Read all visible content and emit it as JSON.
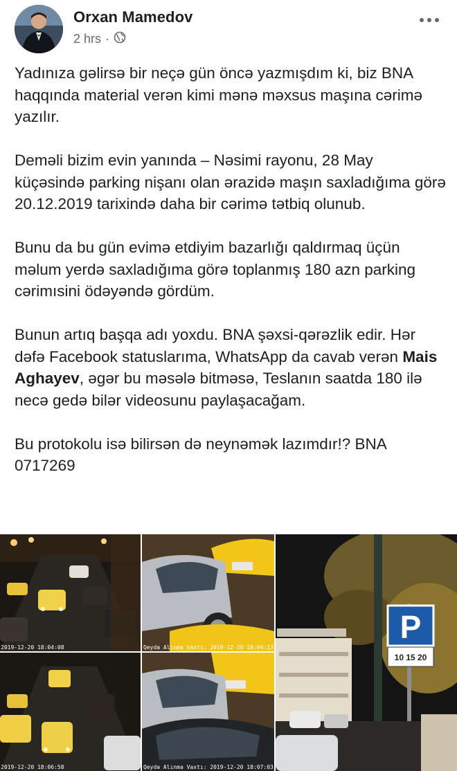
{
  "post": {
    "author": "Orxan Mamedov",
    "time": "2 hrs",
    "separator": "·",
    "privacy_icon": "globe-icon",
    "paragraphs": {
      "p1": "Yadınıza gəlirsə bir neçə gün öncə yazmışdım ki, biz BNA haqqında material verən kimi mənə məxsus maşına cərimə yazılır.",
      "p2": "Deməli bizim evin yanında – Nəsimi rayonu, 28 May küçəsində parking nişanı olan ərazidə maşın saxladığıma görə 20.12.2019 tarixində daha bir cərimə tətbiq olunub.",
      "p3": "Bunu da bu gün evimə etdiyim bazarlığı qaldırmaq üçün məlum yerdə saxladığıma görə toplanmış 180 azn parking cərimısini ödəyəndə gördüm.",
      "p4_before": "Bunun artıq başqa adı yoxdu. BNA şəxsi-qərəzlik edir. Hər dəfə Facebook statuslarıma, WhatsApp da cavab verən ",
      "p4_name": "Mais Aghayev",
      "p4_after": ", əgər bu məsələ bitməsə, Teslanın saatda 180 ilə necə gedə bilər videosunu paylaşacağam.",
      "p5": "Bu protokolu isə bilirsən də neynəmək lazımdır!? BNA 0717269"
    }
  },
  "photos": {
    "ts1": "2019-12-20 18:04:08",
    "ts2": "Qeyda Alınma Vaxtı: 2019-12-20 18:04:13",
    "ts3": "2019-12-20 18:06:58",
    "ts4": "Qeyda Alınma Vaxtı: 2019-12-20 18:07:03",
    "parking_sign_letter": "P",
    "parking_sign_numbers": "10 15 20"
  },
  "colors": {
    "text": "#1c1e21",
    "meta": "#65676b",
    "sign_blue": "#1e5aa8"
  }
}
